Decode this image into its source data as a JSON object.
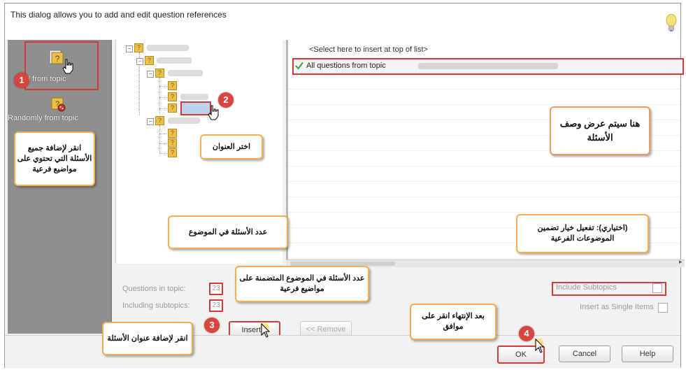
{
  "dialog": {
    "header_text": "This dialog allows you to add and edit question references"
  },
  "left_panel": {
    "items": [
      {
        "label": "All from topic",
        "icon": "all-from-topic-icon"
      },
      {
        "label": "Randomly from topic",
        "icon": "randomly-from-topic-icon"
      }
    ]
  },
  "list": {
    "insert_top": "<Select here to insert at top of list>",
    "selected_item": "All questions from topic"
  },
  "stats": {
    "questions_in_topic_label": "Questions in topic:",
    "questions_in_topic_value": "23",
    "including_subtopics_label": "Including subtopics:",
    "including_subtopics_value": "23"
  },
  "buttons": {
    "insert": "Insert >",
    "remove": "<< Remove",
    "ok": "OK",
    "cancel": "Cancel",
    "help": "Help"
  },
  "options": {
    "include_subtopics": "Include Subtopics",
    "insert_single": "Insert as Single Items"
  },
  "callouts": {
    "c1": "انقر لإضافة جميع الأسئلة التي تحتوي على مواضيع فرعية",
    "c2": "اختر العنوان",
    "c3": "انقر لإضافة عنوان الأسئلة",
    "c4": "بعد الإنتهاء انقر على موافق",
    "list_desc": "هنا سيتم عرض وصف الأسئلة",
    "count_in_topic": "عدد الأسئلة في الموضوع",
    "count_subtopics": "عدد الأسئلة في الموضوع المتضمنة على مواضيع فرعية",
    "optional": "(اختياري): تفعيل خيار تضمين الموضوعات الفرعية"
  },
  "badges": {
    "b1": "1",
    "b2": "2",
    "b3": "3",
    "b4": "4"
  },
  "colors": {
    "badge": "#d9443c",
    "callout_border": "#f0b050",
    "highlight_border": "#d43a3a",
    "check": "#3aa53a"
  }
}
